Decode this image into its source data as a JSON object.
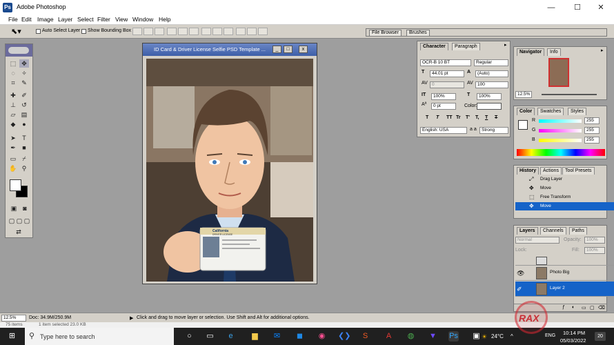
{
  "window": {
    "title": "Adobe Photoshop",
    "logo_text": "Ps",
    "min": "—",
    "max": "☐",
    "close": "✕"
  },
  "menu": [
    "File",
    "Edit",
    "Image",
    "Layer",
    "Select",
    "Filter",
    "View",
    "Window",
    "Help"
  ],
  "options": {
    "auto_select": "Auto Select Layer",
    "show_bbox": "Show Bounding Box"
  },
  "palette_well": {
    "tabs": [
      "File Browser",
      "Brushes"
    ]
  },
  "document": {
    "title": "ID Card & Driver License Selfie PSD Template ...",
    "card_heading": "California",
    "card_sub": "DRIVER LICENSE"
  },
  "character": {
    "tabs": [
      "Character",
      "Paragraph"
    ],
    "font": "OCR-B 10 BT",
    "style": "Regular",
    "size": "44.01 pt",
    "leading": "(Auto)",
    "kerning": "0",
    "tracking": "100",
    "vscale": "100%",
    "hscale": "100%",
    "baseline": "0 pt",
    "color_label": "Color:",
    "faux": [
      "T",
      "T",
      "TT",
      "Tr",
      "T'",
      "T,",
      "T",
      "T"
    ],
    "language": "English: USA",
    "aa_label": "a a",
    "aa": "Strong"
  },
  "navigator": {
    "tabs": [
      "Navigator",
      "Info"
    ],
    "zoom": "12.5%"
  },
  "color": {
    "tabs": [
      "Color",
      "Swatches",
      "Styles"
    ],
    "channels": [
      {
        "label": "R",
        "value": "255"
      },
      {
        "label": "G",
        "value": "255"
      },
      {
        "label": "B",
        "value": "255"
      }
    ]
  },
  "history": {
    "tabs": [
      "History",
      "Actions",
      "Tool Presets"
    ],
    "items": [
      {
        "label": "Drag Layer"
      },
      {
        "label": "Move"
      },
      {
        "label": "Free Transform"
      },
      {
        "label": "Move"
      }
    ]
  },
  "layers": {
    "tabs": [
      "Layers",
      "Channels",
      "Paths"
    ],
    "blend": "Normal",
    "opacity_label": "Opacity:",
    "opacity": "100%",
    "lock_label": "Lock:",
    "fill_label": "Fill:",
    "fill": "100%",
    "items": [
      {
        "name": "Photo Big"
      },
      {
        "name": "Layer 2"
      }
    ]
  },
  "status": {
    "zoom": "12.5%",
    "doc": "Doc: 34.9M/250.9M",
    "hint": "Click and drag to move layer or selection.  Use Shift and Alt for additional options."
  },
  "explorer": {
    "items": "75 items",
    "selected": "1 item selected  23.0 KB"
  },
  "taskbar": {
    "search": "Type here to search",
    "weather": "24°C",
    "lang": "ENG",
    "time": "10:14 PM",
    "date": "05/03/2022",
    "notif": "20"
  },
  "watermark": "RAX",
  "colors": {
    "accent": "#1563c8",
    "title_grad": "#3d5ea8",
    "panel_bg": "#d4d0c8",
    "workspace": "#9e9e9e"
  }
}
